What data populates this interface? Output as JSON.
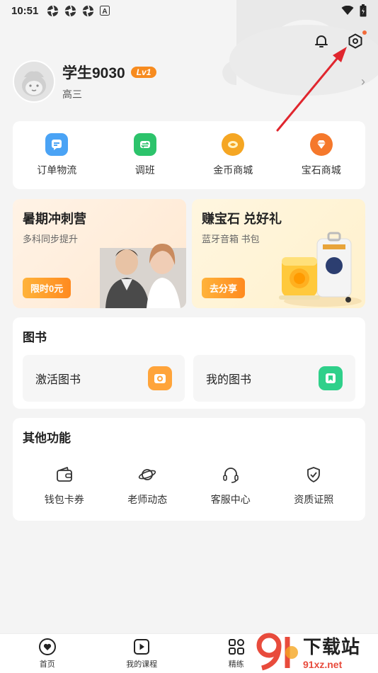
{
  "status_bar": {
    "time": "10:51",
    "notif_icons": [
      "aperture-icon",
      "aperture-icon",
      "aperture-icon",
      "a-box-icon"
    ],
    "right_icons": [
      "wifi-icon",
      "battery-icon"
    ]
  },
  "top_actions": {
    "bell_icon": "bell-icon",
    "settings_icon": "settings-hex-icon"
  },
  "profile": {
    "name": "学生9030",
    "level": "Lv1",
    "grade": "高三",
    "arrow": "›"
  },
  "quick_links": [
    {
      "label": "订单物流",
      "icon": "order-icon",
      "color": "#4aa3f5"
    },
    {
      "label": "调班",
      "icon": "swap-icon",
      "color": "#2cc36b"
    },
    {
      "label": "金币商城",
      "icon": "coin-icon",
      "color": "#f5a623"
    },
    {
      "label": "宝石商城",
      "icon": "gem-icon",
      "color": "#f5782b"
    }
  ],
  "promos": [
    {
      "title": "暑期冲刺营",
      "subtitle": "多科同步提升",
      "button": "限时0元"
    },
    {
      "title": "赚宝石 兑好礼",
      "subtitle": "蓝牙音箱 书包",
      "button": "去分享"
    }
  ],
  "books": {
    "title": "图书",
    "items": [
      {
        "label": "激活图书",
        "icon": "camera-book-icon",
        "color": "#ffa43a"
      },
      {
        "label": "我的图书",
        "icon": "bookmark-icon",
        "color": "#2fd08a"
      }
    ]
  },
  "other": {
    "title": "其他功能",
    "items": [
      {
        "label": "钱包卡券",
        "icon": "wallet-icon"
      },
      {
        "label": "老师动态",
        "icon": "planet-icon"
      },
      {
        "label": "客服中心",
        "icon": "headset-icon"
      },
      {
        "label": "资质证照",
        "icon": "shield-check-icon"
      }
    ]
  },
  "tab_bar": [
    {
      "label": "首页",
      "icon": "home-heart-icon"
    },
    {
      "label": "我的课程",
      "icon": "play-square-icon"
    },
    {
      "label": "精练",
      "icon": "grid-icon"
    },
    {
      "label": "",
      "icon": "more-icon"
    }
  ],
  "watermark": {
    "top": "下载站",
    "bottom": "91xz.net"
  }
}
